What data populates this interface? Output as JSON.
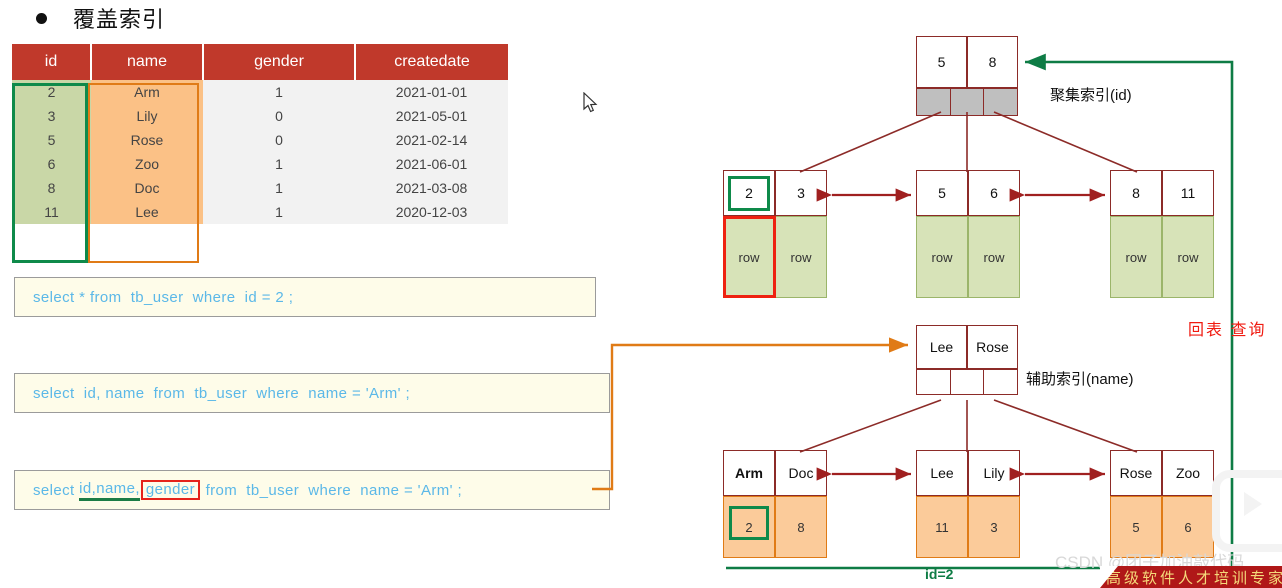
{
  "slide": {
    "bullet_title": "覆盖索引"
  },
  "table": {
    "headers": [
      "id",
      "name",
      "gender",
      "createdate"
    ],
    "rows": [
      [
        "2",
        "Arm",
        "1",
        "2021-01-01"
      ],
      [
        "3",
        "Lily",
        "0",
        "2021-05-01"
      ],
      [
        "5",
        "Rose",
        "0",
        "2021-02-14"
      ],
      [
        "6",
        "Zoo",
        "1",
        "2021-06-01"
      ],
      [
        "8",
        "Doc",
        "1",
        "2021-03-08"
      ],
      [
        "11",
        "Lee",
        "1",
        "2020-12-03"
      ]
    ],
    "highlight_id_column_color": "#0E8A4A",
    "highlight_name_column_color": "#E07B16",
    "header_color": "#C0392B",
    "id_cell_color": "#C9D7A7",
    "name_cell_color": "#FBC186"
  },
  "sql": {
    "stmt1": "select * from  tb_user  where  id = 2 ;",
    "stmt2": "select  id, name  from  tb_user  where  name = 'Arm' ;",
    "stmt3_pre": "select ",
    "stmt3_underlined": "id,name,",
    "stmt3_boxed": "gender",
    "stmt3_post": " from  tb_user  where  name = 'Arm' ;",
    "text_color": "#5BB8E8",
    "bg_color": "#FEFCE9"
  },
  "clustered_index": {
    "label": "聚集索引(id)",
    "root": {
      "keys": [
        "5",
        "8"
      ]
    },
    "leaves": [
      {
        "keys": [
          "2",
          "3"
        ],
        "data": [
          "row",
          "row"
        ]
      },
      {
        "keys": [
          "5",
          "6"
        ],
        "data": [
          "row",
          "row"
        ]
      },
      {
        "keys": [
          "8",
          "11"
        ],
        "data": [
          "row",
          "row"
        ]
      }
    ],
    "data_cell_color": "#D7E3B8"
  },
  "secondary_index": {
    "label": "辅助索引(name)",
    "root": {
      "keys": [
        "Lee",
        "Rose"
      ]
    },
    "leaves": [
      {
        "keys": [
          "Arm",
          "Doc"
        ],
        "data": [
          "2",
          "8"
        ]
      },
      {
        "keys": [
          "Lee",
          "Lily"
        ],
        "data": [
          "11",
          "3"
        ]
      },
      {
        "keys": [
          "Rose",
          "Zoo"
        ],
        "data": [
          "5",
          "6"
        ]
      }
    ],
    "data_cell_color": "#FBCB9A"
  },
  "annotations": {
    "lookup_label": "回表 查询",
    "lookup_color": "#F01A10",
    "id_equals": "id=2",
    "id_equals_color": "#0E7C45",
    "arrow_orange": "#E07B16",
    "arrow_dark_red": "#8C2B28",
    "arrow_green": "#0E7C45",
    "arrow_bright_red": "#CC1111"
  },
  "overlay": {
    "watermark": "CSDN @团子加油敲代码",
    "banner_text": "高级软件人才培训专家"
  }
}
